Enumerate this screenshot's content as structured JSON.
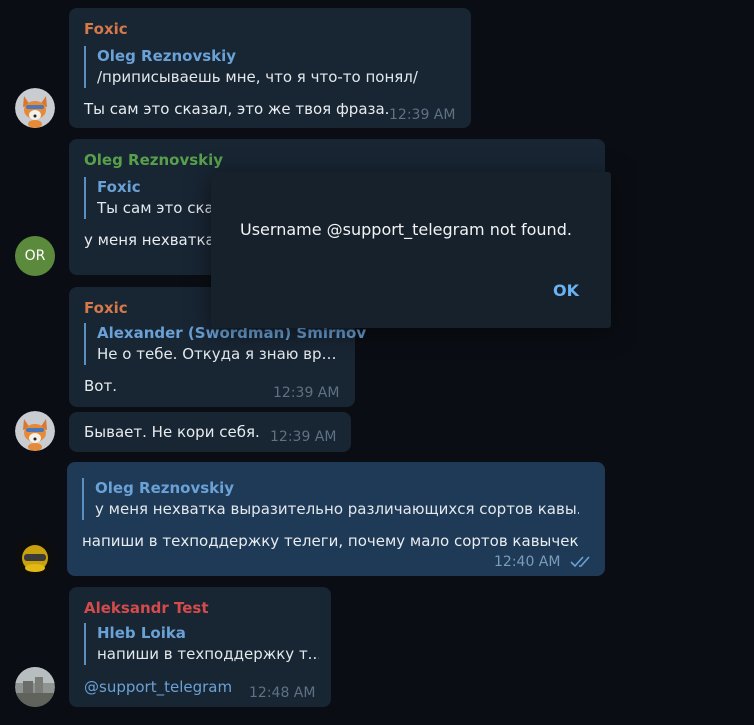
{
  "colors": {
    "background": "#0a0e14",
    "incoming_bubble": "#182533",
    "outgoing_bubble": "#1f3a56",
    "foxic_name": "#d5784a",
    "oleg_name": "#58a04b",
    "aleksandr_name": "#d54b4b",
    "reply_name": "#6aa1d6",
    "accent": "#6ab3f3"
  },
  "messages": [
    {
      "sender": "Foxic",
      "reply_name": "Oleg Reznovskiy",
      "reply_text": "/приписываешь мне, что я что-то понял/",
      "text": "Ты сам это сказал, это же твоя фраза.",
      "time": "12:39 AM"
    },
    {
      "sender": "Oleg Reznovskiy",
      "reply_name": "Foxic",
      "reply_text": "Ты сам это сказ",
      "text": "у меня нехватка",
      "avatar_initials": "OR"
    },
    {
      "sender": "Foxic",
      "reply_name": "Alexander (Swordman) Smirnov",
      "reply_text": "Не о тебе. Откуда я знаю вро...",
      "text": "Вот.",
      "time": "12:39 AM"
    },
    {
      "text": "Бывает. Не кори себя.",
      "time": "12:39 AM"
    },
    {
      "reply_name": "Oleg Reznovskiy",
      "reply_text": "у меня нехватка выразительно различающихся сортов кавы...",
      "text": "напиши в техподдержку телеги, почему мало сортов кавычек",
      "time": "12:40 AM"
    },
    {
      "sender": "Aleksandr Test",
      "reply_name": "Hleb Loika",
      "reply_text": "напиши в техподдержку т...",
      "text": "@support_telegram",
      "time": "12:48 AM"
    }
  ],
  "dialog": {
    "message": "Username @support_telegram not found.",
    "ok_label": "OK"
  }
}
